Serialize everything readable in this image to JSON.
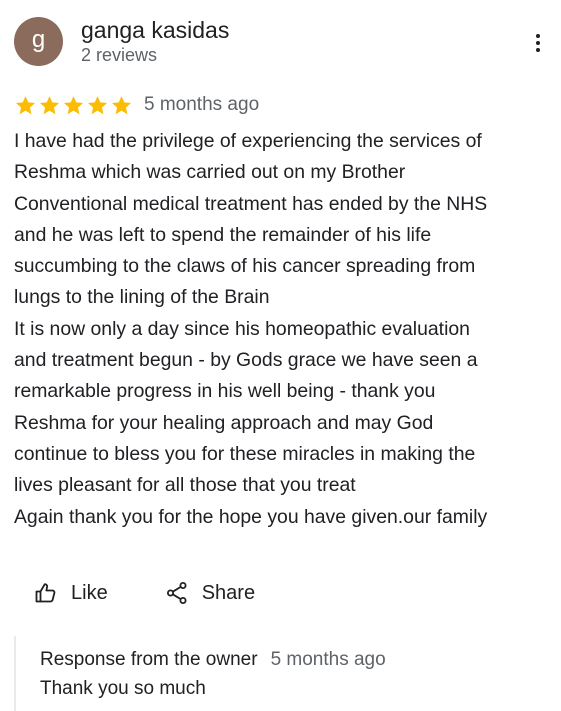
{
  "review": {
    "author": {
      "initial": "g",
      "name": "ganga kasidas",
      "review_count": "2 reviews",
      "avatar_color": "#8a6b5c"
    },
    "menu_icon": "more-vert-icon",
    "rating": 5,
    "rating_max": 5,
    "star_color": "#fbbc04",
    "date": "5 months ago",
    "lines": [
      "I have had the privilege of experiencing the services of",
      "Reshma which was carried out on my Brother",
      "Conventional medical treatment has ended by the NHS",
      "and he was left to spend the remainder of his life",
      "succumbing to the claws of his cancer spreading from",
      "lungs to the lining of the Brain",
      "It is now only a day since his homeopathic evaluation",
      "and treatment begun - by Gods grace we have seen a",
      "remarkable progress in his well being - thank you",
      "Reshma for your healing approach and may God",
      "continue to bless you for these miracles in making the",
      "lives pleasant for all those that you treat",
      "Again thank you for the hope you have given.our family"
    ]
  },
  "actions": {
    "like": {
      "label": "Like",
      "icon": "thumb-up-icon"
    },
    "share": {
      "label": "Share",
      "icon": "share-icon"
    }
  },
  "owner_response": {
    "title": "Response from the owner",
    "date": "5 months ago",
    "text": "Thank you so much"
  }
}
